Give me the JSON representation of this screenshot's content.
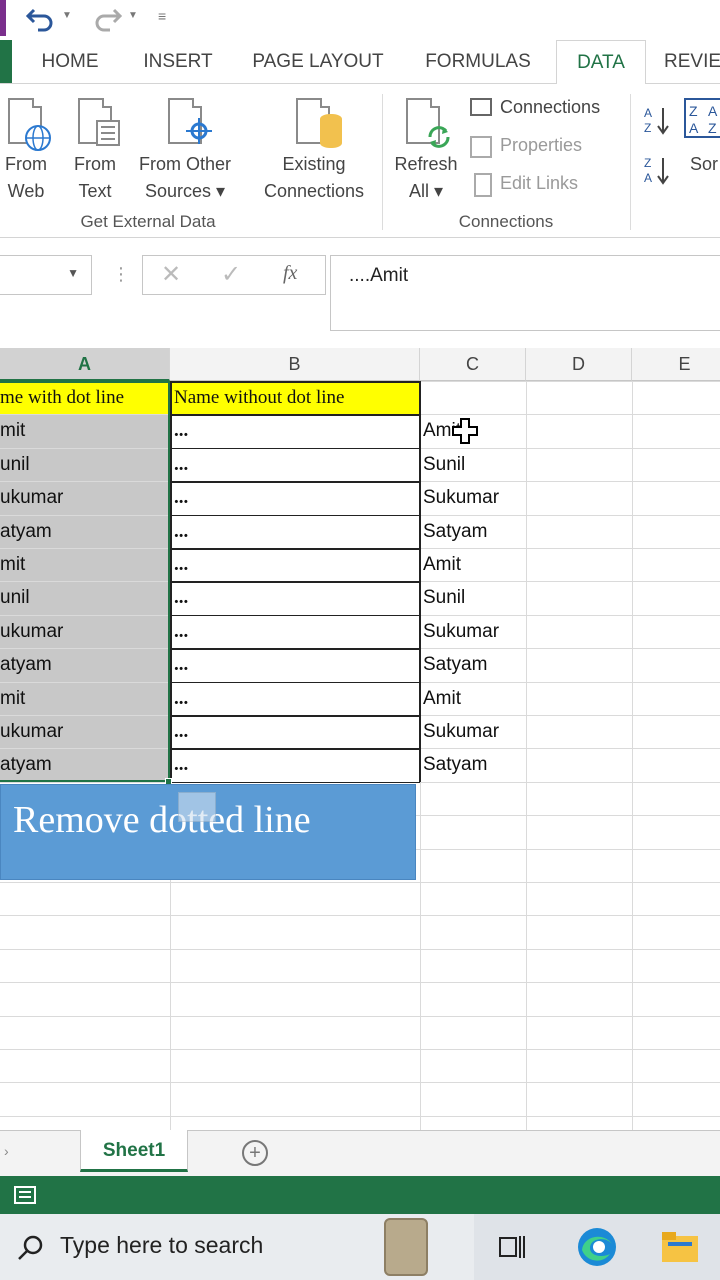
{
  "ribbon_tabs": [
    "HOME",
    "INSERT",
    "PAGE LAYOUT",
    "FORMULAS",
    "DATA",
    "REVIE"
  ],
  "active_tab": "DATA",
  "get_external_data": {
    "from_web": [
      "From",
      "Web"
    ],
    "from_text": [
      "From",
      "Text"
    ],
    "from_other": [
      "From Other",
      "Sources ▾"
    ],
    "existing": [
      "Existing",
      "Connections"
    ],
    "group_label": "Get External Data"
  },
  "connections_group": {
    "refresh": [
      "Refresh",
      "All ▾"
    ],
    "connections": "Connections",
    "properties": "Properties",
    "edit_links": "Edit Links",
    "group_label": "Connections"
  },
  "sort": {
    "label": "Sor"
  },
  "formula_bar": {
    "fx": "fx",
    "value": "....Amit"
  },
  "columns": [
    "A",
    "B",
    "C",
    "D",
    "E"
  ],
  "headers": {
    "a": "me with dot line",
    "b": "Name without dot line"
  },
  "rows": [
    {
      "a": "mit",
      "b": "...",
      "c": "Amit"
    },
    {
      "a": "unil",
      "b": "...",
      "c": "Sunil"
    },
    {
      "a": "ukumar",
      "b": "...",
      "c": "Sukumar"
    },
    {
      "a": "atyam",
      "b": "...",
      "c": "Satyam"
    },
    {
      "a": "mit",
      "b": "...",
      "c": "Amit"
    },
    {
      "a": "unil",
      "b": "...",
      "c": "Sunil"
    },
    {
      "a": "ukumar",
      "b": "...",
      "c": "Sukumar"
    },
    {
      "a": "atyam",
      "b": "...",
      "c": "Satyam"
    },
    {
      "a": "mit",
      "b": "...",
      "c": "Amit"
    },
    {
      "a": "ukumar",
      "b": "...",
      "c": "Sukumar"
    },
    {
      "a": "atyam",
      "b": "...",
      "c": "Satyam"
    }
  ],
  "banner": "Remove dotted line",
  "sheet_tab": "Sheet1",
  "taskbar": {
    "search_placeholder": "Type here to search"
  },
  "colors": {
    "excel_green": "#217346",
    "header_yellow": "#ffff00",
    "banner_blue": "#5b9bd5",
    "selected_gray": "#c8c8c8"
  }
}
